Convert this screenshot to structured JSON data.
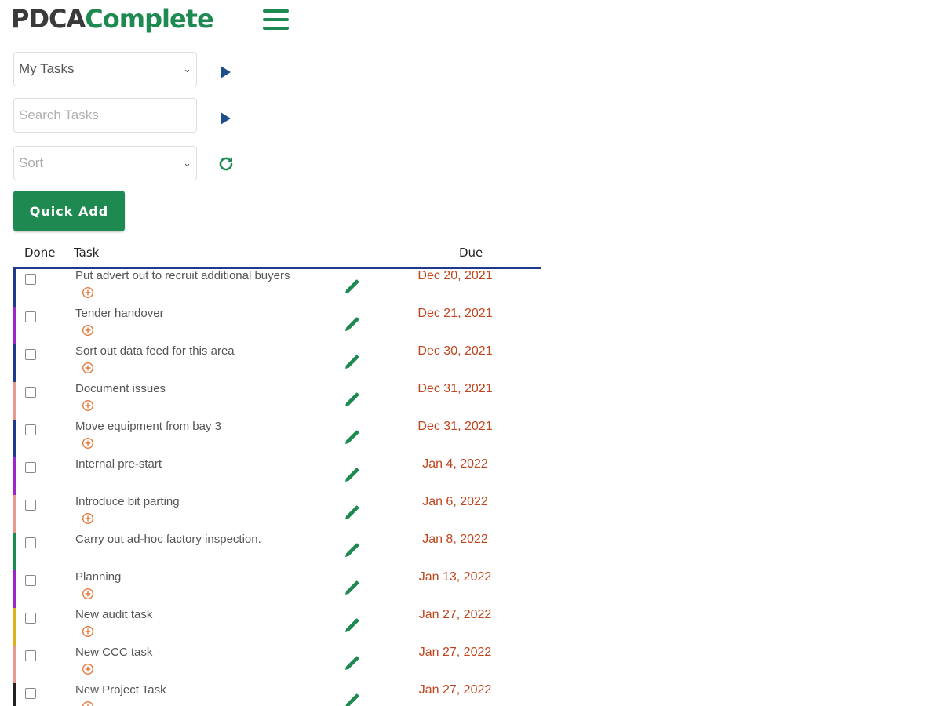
{
  "brand": {
    "part1": "PDCA",
    "part2": "Complete"
  },
  "filters": {
    "view_select": "My Tasks",
    "search_placeholder": "Search Tasks",
    "sort_select": "Sort"
  },
  "quick_add_label": "Quick Add",
  "table": {
    "headers": {
      "done": "Done",
      "task": "Task",
      "due": "Due"
    },
    "rows": [
      {
        "task": "Put advert out to recruit additional buyers",
        "due": "Dec 20, 2021",
        "color": "#1f3a8c",
        "has_add": true
      },
      {
        "task": "Tender handover",
        "due": "Dec 21, 2021",
        "color": "#9b27c9",
        "has_add": true
      },
      {
        "task": "Sort out data feed for this area",
        "due": "Dec 30, 2021",
        "color": "#1f3a8c",
        "has_add": true
      },
      {
        "task": "Document issues",
        "due": "Dec 31, 2021",
        "color": "#e59a8e",
        "has_add": true
      },
      {
        "task": "Move equipment from bay 3",
        "due": "Dec 31, 2021",
        "color": "#1f3a8c",
        "has_add": true
      },
      {
        "task": "Internal pre-start",
        "due": "Jan 4, 2022",
        "color": "#9b27c9",
        "has_add": false
      },
      {
        "task": "Introduce bit parting",
        "due": "Jan 6, 2022",
        "color": "#e59a8e",
        "has_add": true
      },
      {
        "task": "Carry out ad-hoc factory inspection.",
        "due": "Jan 8, 2022",
        "color": "#1e8a52",
        "has_add": false
      },
      {
        "task": "Planning",
        "due": "Jan 13, 2022",
        "color": "#9b27c9",
        "has_add": true
      },
      {
        "task": "New audit task",
        "due": "Jan 27, 2022",
        "color": "#d9b21c",
        "has_add": true
      },
      {
        "task": "New CCC task",
        "due": "Jan 27, 2022",
        "color": "#e59a8e",
        "has_add": true
      },
      {
        "task": "New Project Task",
        "due": "Jan 27, 2022",
        "color": "#222222",
        "has_add": true
      }
    ]
  },
  "colors": {
    "brand_green": "#1e8a52",
    "brand_dark": "#3a3a3a",
    "accent_blue": "#1f4e8c",
    "due_text": "#c0441c",
    "add_icon": "#e07a3c"
  },
  "icons": {
    "menu": "hamburger-icon",
    "apply": "play-icon",
    "refresh": "refresh-icon",
    "add_subtask": "plus-circle-icon",
    "edit": "pencil-icon"
  }
}
